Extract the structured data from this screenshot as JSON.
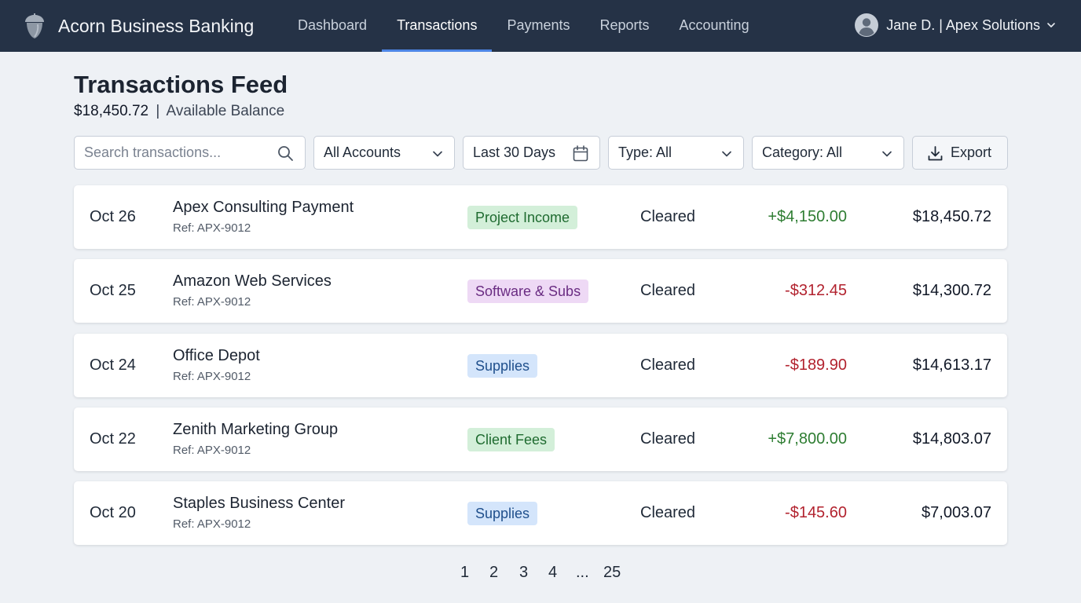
{
  "app": {
    "name": "Acorn Business Banking",
    "logo_icon": "acorn-icon"
  },
  "nav": {
    "items": [
      {
        "label": "Dashboard",
        "active": false
      },
      {
        "label": "Transactions",
        "active": true
      },
      {
        "label": "Payments",
        "active": false
      },
      {
        "label": "Reports",
        "active": false
      },
      {
        "label": "Accounting",
        "active": false
      }
    ]
  },
  "user": {
    "label": "Jane D. | Apex Solutions",
    "avatar_icon": "user-avatar-icon"
  },
  "page": {
    "title": "Transactions Feed",
    "balance_amount": "$18,450.72",
    "balance_separator": "|",
    "balance_label": "Available Balance"
  },
  "toolbar": {
    "search_placeholder": "Search transactions...",
    "search_value": "",
    "accounts_label": "All Accounts",
    "date_range_label": "Last 30 Days",
    "type_label": "Type: All",
    "category_label": "Category: All",
    "export_label": "Export"
  },
  "transactions": [
    {
      "date": "Oct 26",
      "description": "Apex Consulting Payment",
      "ref": "Ref: APX-9012",
      "category": "Project Income",
      "category_bg": "#d3efd9",
      "category_fg": "#1f6b30",
      "status": "Cleared",
      "amount": "+$4,150.00",
      "direction": "credit",
      "balance": "$18,450.72"
    },
    {
      "date": "Oct 25",
      "description": "Amazon Web Services",
      "ref": "Ref: APX-9012",
      "category": "Software & Subs",
      "category_bg": "#eed9f5",
      "category_fg": "#6a2c82",
      "status": "Cleared",
      "amount": "-$312.45",
      "direction": "debit",
      "balance": "$14,300.72"
    },
    {
      "date": "Oct 24",
      "description": "Office Depot",
      "ref": "Ref: APX-9012",
      "category": "Supplies",
      "category_bg": "#d4e5fb",
      "category_fg": "#1f4f8c",
      "status": "Cleared",
      "amount": "-$189.90",
      "direction": "debit",
      "balance": "$14,613.17"
    },
    {
      "date": "Oct 22",
      "description": "Zenith Marketing Group",
      "ref": "Ref: APX-9012",
      "category": "Client Fees",
      "category_bg": "#d3efd9",
      "category_fg": "#1f6b30",
      "status": "Cleared",
      "amount": "+$7,800.00",
      "direction": "credit",
      "balance": "$14,803.07"
    },
    {
      "date": "Oct 20",
      "description": "Staples Business Center",
      "ref": "Ref: APX-9012",
      "category": "Supplies",
      "category_bg": "#d4e5fb",
      "category_fg": "#1f4f8c",
      "status": "Cleared",
      "amount": "-$145.60",
      "direction": "debit",
      "balance": "$7,003.07"
    }
  ],
  "pagination": {
    "pages": [
      "1",
      "2",
      "3",
      "4",
      "...",
      "25"
    ],
    "current": "1"
  },
  "colors": {
    "topbar": "#253246",
    "active_tab_underline": "#4d86e6",
    "credit": "#2e7d32",
    "debit": "#b2222e",
    "page_bg": "#eef1f5"
  }
}
